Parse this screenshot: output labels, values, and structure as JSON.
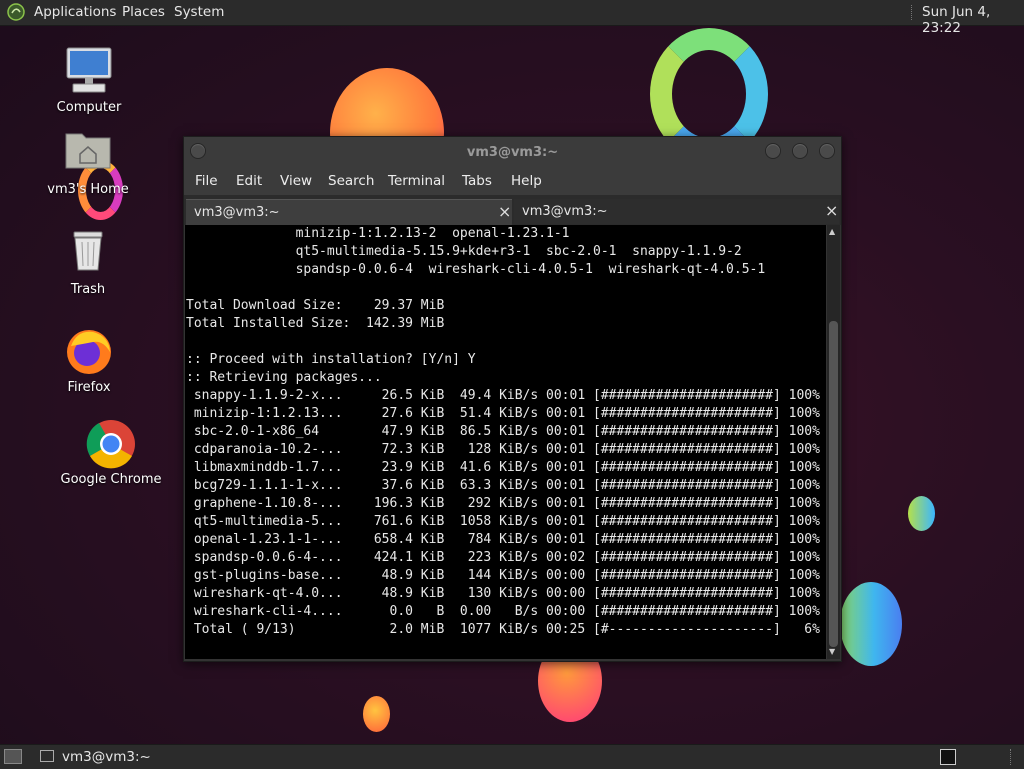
{
  "top_panel": {
    "menus": [
      "Applications",
      "Places",
      "System"
    ],
    "clock": "Sun Jun  4, 23:22"
  },
  "desktop_icons": [
    {
      "label": "Computer",
      "icon": "computer-icon"
    },
    {
      "label": "vm3's Home",
      "icon": "home-folder-icon"
    },
    {
      "label": "Trash",
      "icon": "trash-icon"
    },
    {
      "label": "Firefox",
      "icon": "firefox-icon"
    },
    {
      "label": "Google Chrome",
      "icon": "chrome-icon"
    }
  ],
  "terminal": {
    "title": "vm3@vm3:~",
    "menu": [
      "File",
      "Edit",
      "View",
      "Search",
      "Terminal",
      "Tabs",
      "Help"
    ],
    "tabs": [
      {
        "label": "vm3@vm3:~",
        "active": true
      },
      {
        "label": "vm3@vm3:~",
        "active": false
      }
    ],
    "close_glyph": "×",
    "lines": [
      "              minizip-1:1.2.13-2  openal-1.23.1-1",
      "              qt5-multimedia-5.15.9+kde+r3-1  sbc-2.0-1  snappy-1.1.9-2",
      "              spandsp-0.0.6-4  wireshark-cli-4.0.5-1  wireshark-qt-4.0.5-1",
      "",
      "Total Download Size:    29.37 MiB",
      "Total Installed Size:  142.39 MiB",
      "",
      ":: Proceed with installation? [Y/n] Y",
      ":: Retrieving packages...",
      " snappy-1.1.9-2-x...     26.5 KiB  49.4 KiB/s 00:01 [######################] 100%",
      " minizip-1:1.2.13...     27.6 KiB  51.4 KiB/s 00:01 [######################] 100%",
      " sbc-2.0-1-x86_64        47.9 KiB  86.5 KiB/s 00:01 [######################] 100%",
      " cdparanoia-10.2-...     72.3 KiB   128 KiB/s 00:01 [######################] 100%",
      " libmaxminddb-1.7...     23.9 KiB  41.6 KiB/s 00:01 [######################] 100%",
      " bcg729-1.1.1-1-x...     37.6 KiB  63.3 KiB/s 00:01 [######################] 100%",
      " graphene-1.10.8-...    196.3 KiB   292 KiB/s 00:01 [######################] 100%",
      " qt5-multimedia-5...    761.6 KiB  1058 KiB/s 00:01 [######################] 100%",
      " openal-1.23.1-1-...    658.4 KiB   784 KiB/s 00:01 [######################] 100%",
      " spandsp-0.0.6-4-...    424.1 KiB   223 KiB/s 00:02 [######################] 100%",
      " gst-plugins-base...     48.9 KiB   144 KiB/s 00:00 [######################] 100%",
      " wireshark-qt-4.0...     48.9 KiB   130 KiB/s 00:00 [######################] 100%",
      " wireshark-cli-4....      0.0   B  0.00   B/s 00:00 [######################] 100%",
      " Total ( 9/13)            2.0 MiB  1077 KiB/s 00:25 [#---------------------]   6%"
    ]
  },
  "bottom_panel": {
    "task_label": "vm3@vm3:~"
  },
  "colors": {
    "panel": "#2b2b2b",
    "terminal_bg": "#000000",
    "terminal_fg": "#e8e8e8"
  }
}
